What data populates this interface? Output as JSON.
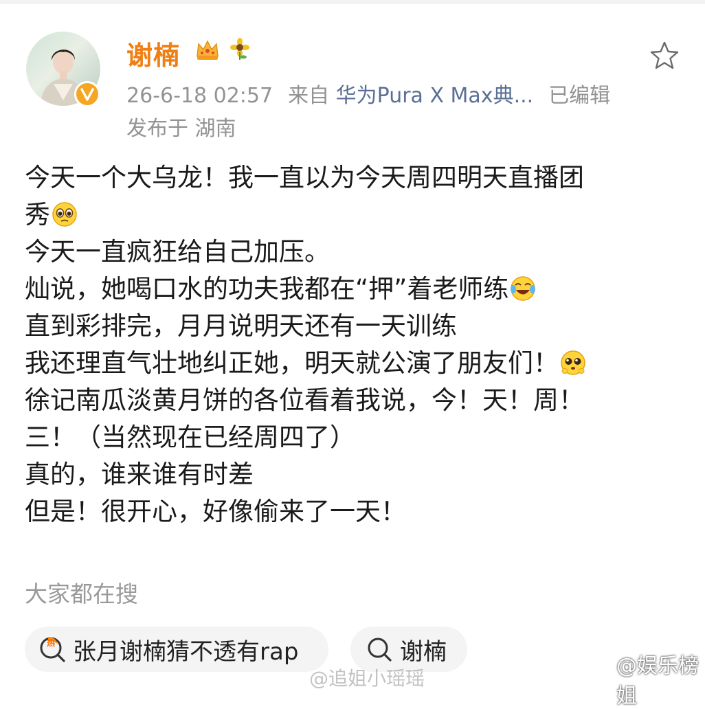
{
  "post": {
    "username": "谢楠",
    "timestamp": "26-6-18 02:57",
    "source_prefix": "来自",
    "source_device": "华为Pura X Max典...",
    "edited": "已编辑",
    "location": "发布于 湖南",
    "lines": [
      "今天一个大乌龙！我一直以为今天周四明天直播团",
      "秀",
      "今天一直疯狂给自己加压。",
      "灿说，她喝口水的功夫我都在“押”着老师练",
      "直到彩排完，月月说明天还有一天训练",
      "我还理直气壮地纠正她，明天就公演了朋友们！",
      "徐记南瓜淡黄月饼的各位看着我说，今！天！周！",
      "三！（当然现在已经周四了）",
      "真的，谁来谁有时差",
      "但是！很开心，好像偷来了一天！"
    ]
  },
  "search": {
    "hint": "大家都在搜",
    "chips": [
      "张月谢楠猜不透有rap",
      "谢楠"
    ]
  },
  "watermark": {
    "text": "@娱乐榜姐",
    "faint": "@追姐小瑶瑶"
  },
  "colors": {
    "username": "#f07f13",
    "meta": "#939393",
    "source_link": "#5a6f95",
    "verified_badge": "#f5a623"
  }
}
